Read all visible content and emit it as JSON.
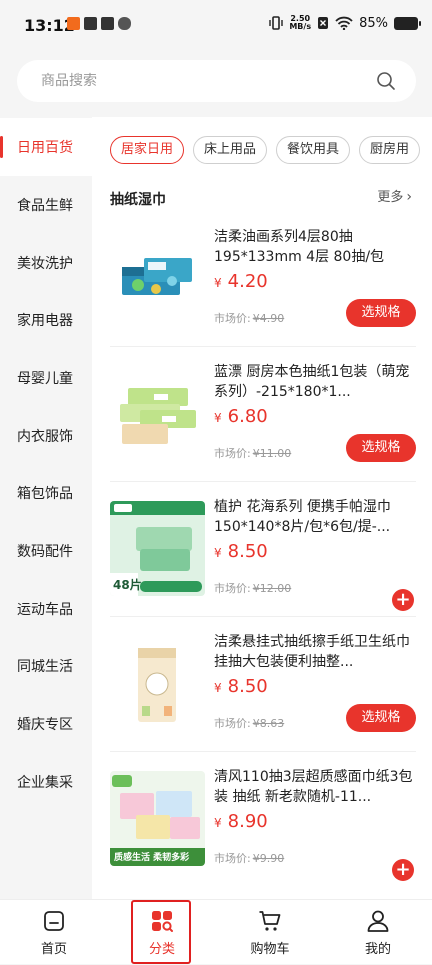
{
  "status": {
    "time": "13:12",
    "net_speed_value": "2.50",
    "net_speed_unit": "MB/s",
    "battery": "85%"
  },
  "search": {
    "placeholder": "商品搜索"
  },
  "categories": [
    "日用百货",
    "食品生鲜",
    "美妆洗护",
    "家用电器",
    "母婴儿童",
    "内衣服饰",
    "箱包饰品",
    "数码配件",
    "运动车品",
    "同城生活",
    "婚庆专区",
    "企业集采"
  ],
  "chips": [
    "居家日用",
    "床上用品",
    "餐饮用具",
    "厨房用"
  ],
  "section": {
    "title": "抽纸湿巾",
    "more": "更多"
  },
  "market_label": "市场价:",
  "currency": "¥",
  "spec_label": "选规格",
  "products": [
    {
      "title": "洁柔油画系列4层80抽 195*133mm 4层 80抽/包",
      "price": "4.20",
      "market": "¥4.90",
      "action": "spec"
    },
    {
      "title": "蓝漂 厨房本色抽纸1包装（萌宠系列）-215*180*1...",
      "price": "6.80",
      "market": "¥11.00",
      "action": "spec"
    },
    {
      "title": "植护 花海系列 便携手帕湿巾150*140*8片/包*6包/提-...",
      "price": "8.50",
      "market": "¥12.00",
      "action": "add"
    },
    {
      "title": "洁柔悬挂式抽纸擦手纸卫生纸巾挂抽大包装便利抽整...",
      "price": "8.50",
      "market": "¥8.63",
      "action": "spec"
    },
    {
      "title": "清风110抽3层超质感面巾纸3包装 抽纸 新老款随机-11...",
      "price": "8.90",
      "market": "¥9.90",
      "action": "add"
    }
  ],
  "thumb_text": {
    "p3_badge": "48片",
    "p5_banner": "质感生活 柔韧多彩"
  },
  "tabs": [
    "首页",
    "分类",
    "购物车",
    "我的"
  ],
  "colors": {
    "accent": "#e8342c"
  }
}
